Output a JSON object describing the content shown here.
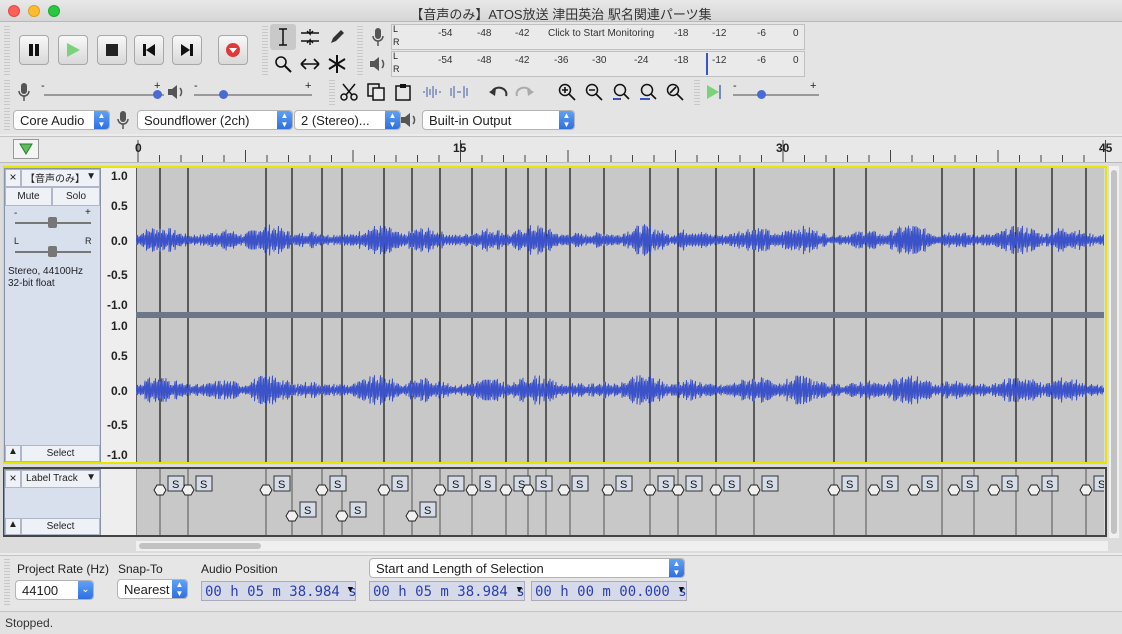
{
  "window": {
    "title": "【音声のみ】ATOS放送 津田英治 駅名関連パーツ集"
  },
  "colors": {
    "waveform": "#3b52c8",
    "track_bg": "#c8c8c8",
    "selected_border": "#e6e600",
    "meter_marker": "#3b52c8"
  },
  "transport": {
    "pause": "pause-icon",
    "play": "play-icon",
    "stop": "stop-icon",
    "skip_start": "skip-start-icon",
    "skip_end": "skip-end-icon",
    "record": "record-icon"
  },
  "meters": {
    "record_L": "L",
    "record_R": "R",
    "play_L": "L",
    "play_R": "R",
    "monitor_label": "Click to Start Monitoring",
    "record_ticks": [
      "-54",
      "-48",
      "-42",
      "-18",
      "-12",
      "-6",
      "0"
    ],
    "play_ticks": [
      "-54",
      "-48",
      "-42",
      "-36",
      "-30",
      "-24",
      "-18",
      "-12",
      "-6",
      "0"
    ]
  },
  "devices": {
    "host": "Core Audio",
    "input": "Soundflower (2ch)",
    "channels": "2 (Stereo)...",
    "output": "Built-in Output"
  },
  "timeline": {
    "ticks": [
      "0",
      "15",
      "30",
      "45"
    ]
  },
  "audio_track": {
    "name": "【音声のみ】",
    "mute": "Mute",
    "solo": "Solo",
    "pan_left": "L",
    "pan_right": "R",
    "gain_minus": "-",
    "gain_plus": "+",
    "info_line1": "Stereo, 44100Hz",
    "info_line2": "32-bit float",
    "select": "Select",
    "close": "×",
    "scale_top": [
      "1.0",
      "0.5",
      "0.0",
      "-0.5",
      "-1.0"
    ],
    "scale_bottom": [
      "1.0",
      "0.5",
      "0.0",
      "-0.5",
      "-1.0"
    ]
  },
  "label_track": {
    "name": "Label Track",
    "select": "Select",
    "close": "×",
    "label_text": "S"
  },
  "bottom": {
    "project_rate_label": "Project Rate (Hz)",
    "project_rate": "44100",
    "snap_label": "Snap-To",
    "snap_value": "Nearest",
    "audio_pos_label": "Audio Position",
    "audio_pos": "00 h 05 m 38.984 s",
    "selection_mode": "Start and Length of Selection",
    "sel_start": "00 h 05 m 38.984 s",
    "sel_length": "00 h 00 m 00.000 s"
  },
  "status": {
    "text": "Stopped."
  }
}
